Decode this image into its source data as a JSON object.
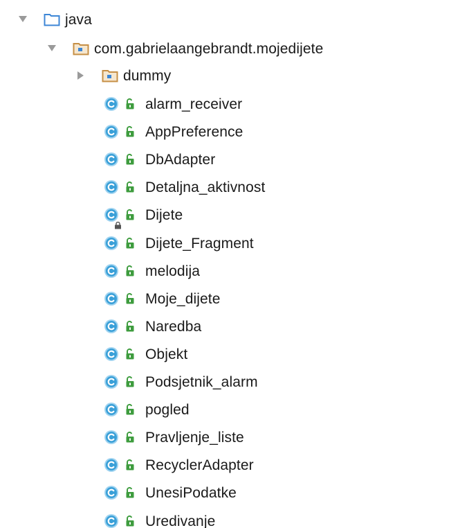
{
  "tree": {
    "root": {
      "label": "java",
      "expanded": true,
      "icon": "source-folder-icon"
    },
    "package": {
      "label": "com.gabrielaangebrandt.mojedijete",
      "expanded": true,
      "icon": "package-icon"
    },
    "subpackage": {
      "label": "dummy",
      "expanded": false,
      "icon": "package-icon"
    },
    "classes": [
      {
        "label": "alarm_receiver",
        "locked": false
      },
      {
        "label": "AppPreference",
        "locked": false
      },
      {
        "label": "DbAdapter",
        "locked": false
      },
      {
        "label": "Detaljna_aktivnost",
        "locked": false
      },
      {
        "label": "Dijete",
        "locked": true
      },
      {
        "label": "Dijete_Fragment",
        "locked": false
      },
      {
        "label": "melodija",
        "locked": false
      },
      {
        "label": "Moje_dijete",
        "locked": false
      },
      {
        "label": "Naredba",
        "locked": false
      },
      {
        "label": "Objekt",
        "locked": false
      },
      {
        "label": "Podsjetnik_alarm",
        "locked": false
      },
      {
        "label": "pogled",
        "locked": false
      },
      {
        "label": "Pravljenje_liste",
        "locked": false
      },
      {
        "label": "RecyclerAdapter",
        "locked": false
      },
      {
        "label": "UnesiPodatke",
        "locked": false
      },
      {
        "label": "Uredivanje",
        "locked": false
      }
    ]
  },
  "colors": {
    "class_circle": "#3aa0d8",
    "class_circle_light": "#9fd3f0",
    "public_green": "#3e9c3e",
    "source_folder_blue": "#3c86d6",
    "package_brown": "#c68f45",
    "toggle_gray": "#9a9a9a"
  }
}
